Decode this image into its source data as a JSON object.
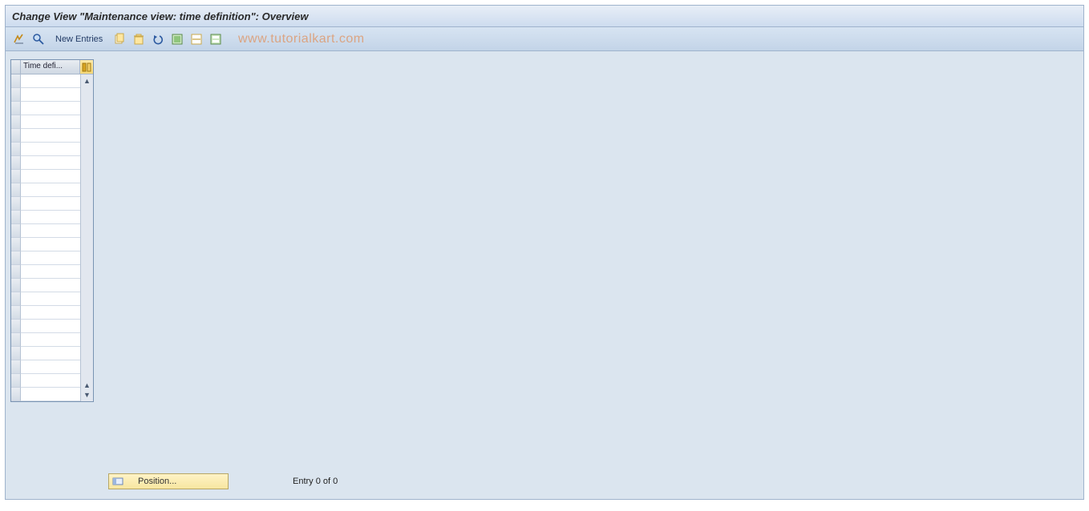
{
  "title": "Change View \"Maintenance view: time definition\": Overview",
  "toolbar": {
    "new_entries_label": "New Entries"
  },
  "watermark": "www.tutorialkart.com",
  "table": {
    "header_label": "Time defi...",
    "row_count": 24
  },
  "footer": {
    "position_label": "Position...",
    "entry_text": "Entry 0 of 0"
  },
  "icons": {
    "toggle": "toggle-display-change-icon",
    "find": "find-icon",
    "copy": "copy-icon",
    "delete": "delete-icon",
    "undo": "undo-icon",
    "select_all": "select-all-icon",
    "deselect": "deselect-all-icon",
    "print": "print-icon",
    "config": "table-settings-icon",
    "position": "position-icon"
  }
}
